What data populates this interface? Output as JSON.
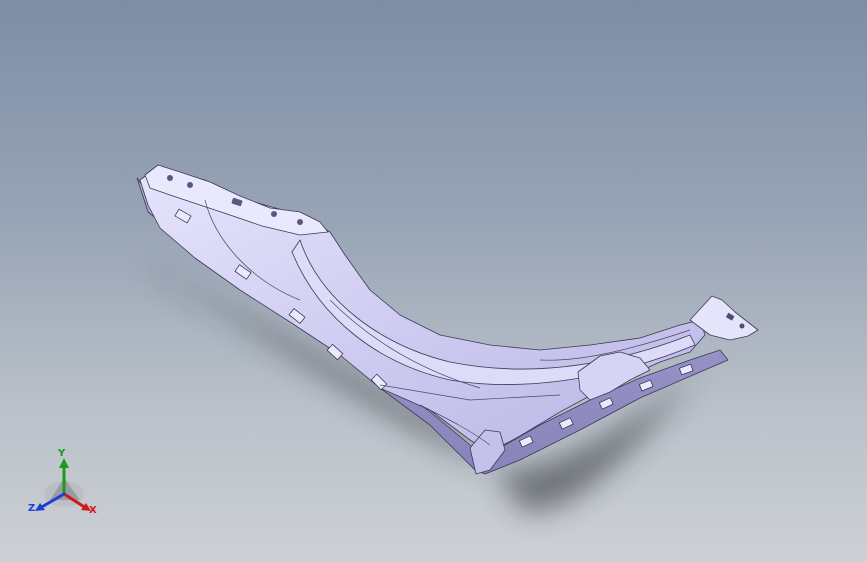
{
  "app": {
    "type": "CAD 3D viewport",
    "background_colors": [
      "#7e8ea6",
      "#cdd1d6"
    ],
    "model_color": "#cfcdf2"
  },
  "triad": {
    "axes": [
      {
        "label": "Y",
        "color": "#1c9a1c"
      },
      {
        "label": "X",
        "color": "#d01818"
      },
      {
        "label": "Z",
        "color": "#1f3fd0"
      }
    ]
  }
}
